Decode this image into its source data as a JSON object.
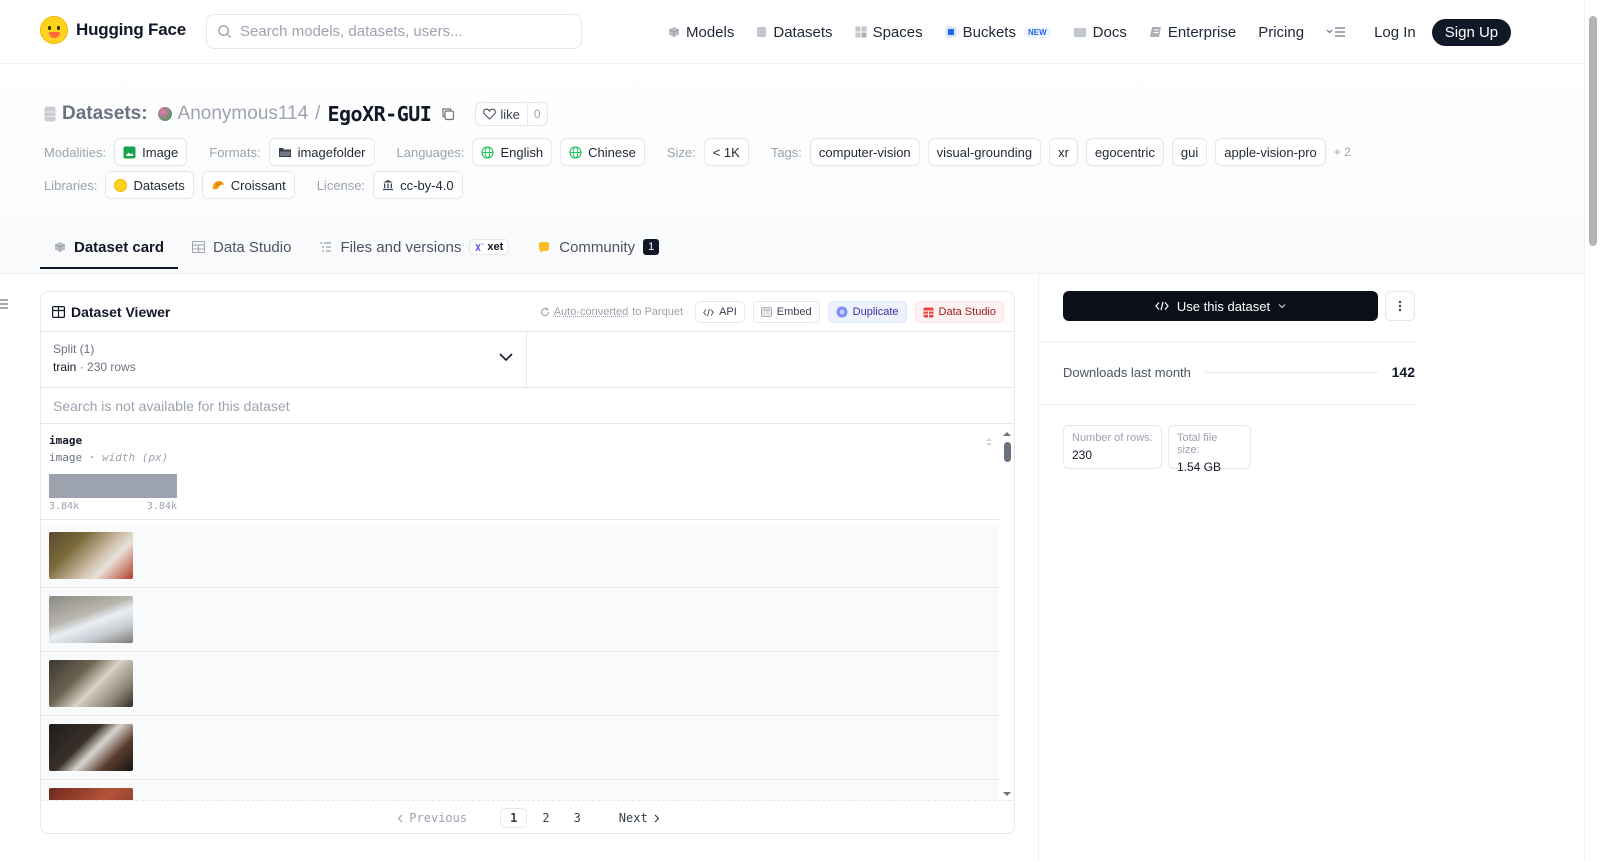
{
  "nav": {
    "brand": "Hugging Face",
    "search_placeholder": "Search models, datasets, users...",
    "links": [
      "Models",
      "Datasets",
      "Spaces",
      "Buckets",
      "Docs",
      "Enterprise",
      "Pricing"
    ],
    "buckets_badge": "NEW",
    "login": "Log In",
    "signup": "Sign Up"
  },
  "header": {
    "section_label": "Datasets:",
    "owner": "Anonymous114",
    "repo": "EgoXR-GUI",
    "like_label": "like",
    "like_count": "0"
  },
  "meta": {
    "modalities_key": "Modalities:",
    "modality": "Image",
    "formats_key": "Formats:",
    "format": "imagefolder",
    "languages_key": "Languages:",
    "languages": [
      "English",
      "Chinese"
    ],
    "size_key": "Size:",
    "size": "< 1K",
    "tags_key": "Tags:",
    "tags": [
      "computer-vision",
      "visual-grounding",
      "xr",
      "egocentric",
      "gui",
      "apple-vision-pro"
    ],
    "tags_more": "+ 2",
    "libraries_key": "Libraries:",
    "libraries": [
      "Datasets",
      "Croissant"
    ],
    "license_key": "License:",
    "license": "cc-by-4.0"
  },
  "tabs": {
    "card": "Dataset card",
    "studio": "Data Studio",
    "files": "Files and versions",
    "xet": "xet",
    "community": "Community",
    "community_count": "1"
  },
  "viewer": {
    "title": "Dataset Viewer",
    "auto_converted": "Auto-converted",
    "to_parquet": "to Parquet",
    "api": "API",
    "embed": "Embed",
    "duplicate": "Duplicate",
    "data_studio": "Data Studio",
    "split_label": "Split (1)",
    "split_name": "train",
    "split_rows": "230 rows",
    "search_msg": "Search is not available for this dataset",
    "column_name": "image",
    "column_type": "image",
    "column_sub": "width (px)",
    "hist_min": "3.84k",
    "hist_max": "3.84k",
    "pager": {
      "prev": "Previous",
      "pages": [
        "1",
        "2",
        "3"
      ],
      "current": "1",
      "next": "Next"
    }
  },
  "sidebar": {
    "use_dataset": "Use this dataset",
    "downloads_label": "Downloads last month",
    "downloads_value": "142",
    "rows_label": "Number of rows:",
    "rows_value": "230",
    "size_label": "Total file size:",
    "size_value": "1.54 GB"
  },
  "colors": {
    "primary_dark": "#0b0f19",
    "brand_yellow": "#ffd21e",
    "muted": "#9ca3af"
  }
}
